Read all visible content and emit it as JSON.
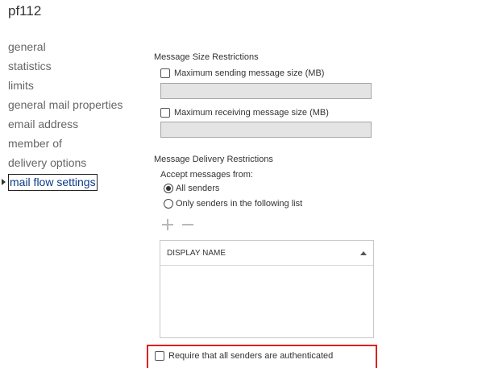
{
  "header": {
    "title": "pf112"
  },
  "nav": {
    "items": [
      {
        "label": "general"
      },
      {
        "label": "statistics"
      },
      {
        "label": "limits"
      },
      {
        "label": "general mail properties"
      },
      {
        "label": "email address"
      },
      {
        "label": "member of"
      },
      {
        "label": "delivery options"
      },
      {
        "label": "mail flow settings",
        "selected": true
      }
    ]
  },
  "size_restrictions": {
    "heading": "Message Size Restrictions",
    "max_send_label": "Maximum sending message size (MB)",
    "max_send_value": "",
    "max_send_checked": false,
    "max_receive_label": "Maximum receiving message size (MB)",
    "max_receive_value": "",
    "max_receive_checked": false
  },
  "delivery_restrictions": {
    "heading": "Message Delivery Restrictions",
    "accept_label": "Accept messages from:",
    "radio_all": "All senders",
    "radio_only": "Only senders in the following list",
    "selected": "all",
    "list_column": "DISPLAY NAME",
    "list_items": [],
    "require_auth_label": "Require that all senders are authenticated",
    "require_auth_checked": false
  },
  "colors": {
    "highlight": "#e02020",
    "nav_selected": "#0b3a86"
  },
  "icons": [
    "expand-arrow-icon",
    "plus-icon",
    "minus-icon",
    "sort-up-icon"
  ]
}
